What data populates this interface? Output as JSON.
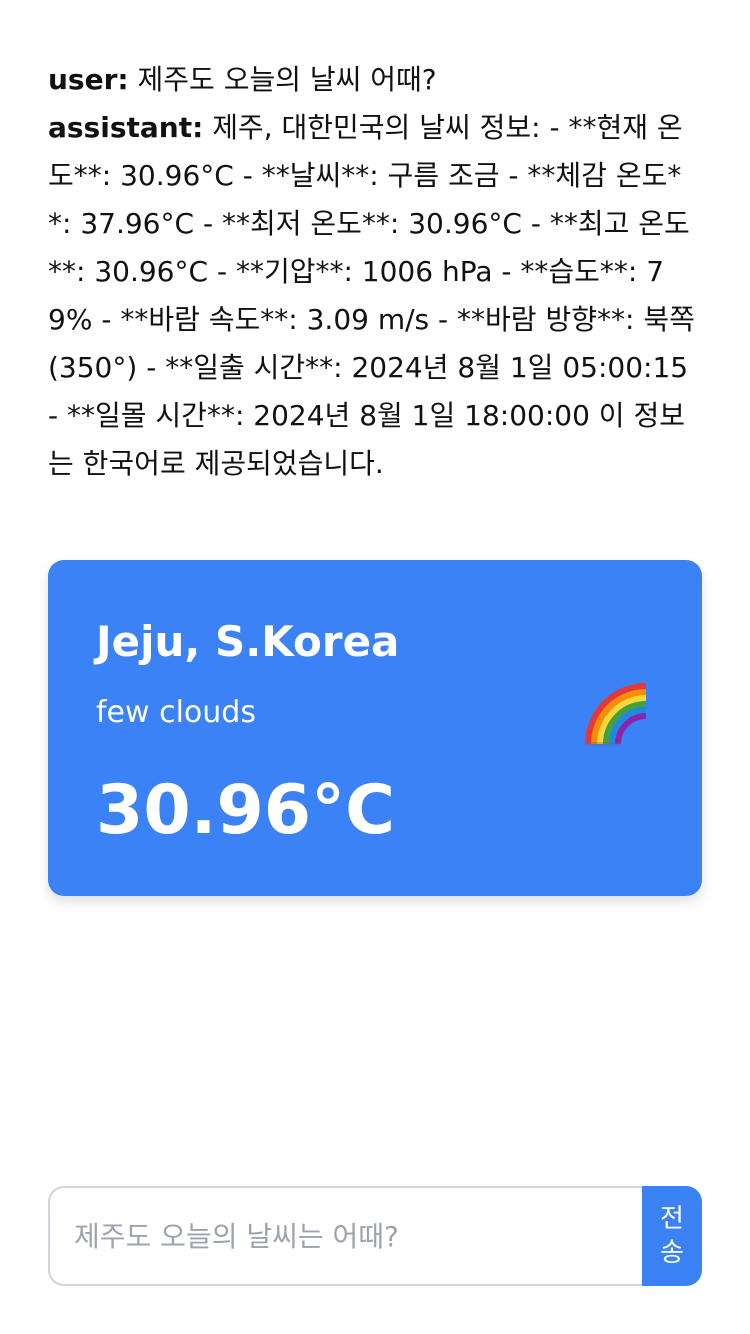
{
  "chat": {
    "messages": [
      {
        "speaker": "user:",
        "text": " 제주도 오늘의 날씨 어때?"
      },
      {
        "speaker": "assistant:",
        "text": " 제주, 대한민국의 날씨 정보: - **현재 온도**: 30.96°C - **날씨**: 구름 조금 - **체감 온도**: 37.96°C - **최저 온도**: 30.96°C - **최고 온도**: 30.96°C - **기압**: 1006 hPa - **습도**: 79% - **바람 속도**: 3.09 m/s - **바람 방향**: 북쪽 (350°) - **일출 시간**: 2024년 8월 1일 05:00:15 - **일몰 시간**: 2024년 8월 1일 18:00:00 이 정보는 한국어로 제공되었습니다."
      }
    ]
  },
  "weather_card": {
    "city": "Jeju, S.Korea",
    "condition": "few clouds",
    "temperature": "30.96°C",
    "icon": "rainbow-icon",
    "background_color": "#3b82f6"
  },
  "composer": {
    "placeholder": "제주도 오늘의 날씨는 어때?",
    "value": "",
    "send_label": "전송",
    "accent_color": "#3b82f6"
  }
}
